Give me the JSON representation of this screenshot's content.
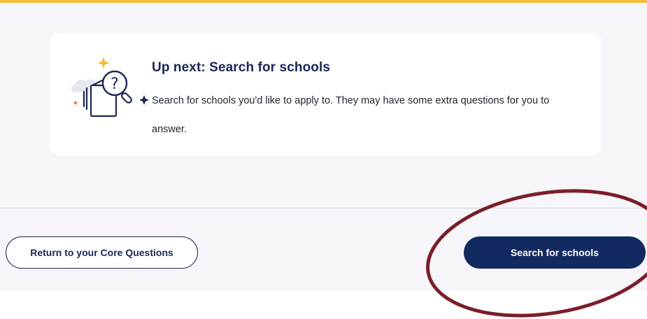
{
  "header": {
    "accent_color": "#f5be3a"
  },
  "next_step_card": {
    "icon": "search-document-icon",
    "title": "Up next: Search for schools",
    "description": "Search for schools you'd like to apply to. They may have some extra questions for you to answer."
  },
  "actions": {
    "return_label": "Return to your Core Questions",
    "search_label": "Search for schools"
  },
  "annotation": {
    "highlight_color": "#7a1f2b",
    "target": "search-for-schools-button"
  },
  "colors": {
    "brand_navy": "#112a5f",
    "title_navy": "#1a2656",
    "page_background": "#f6f6fa"
  }
}
